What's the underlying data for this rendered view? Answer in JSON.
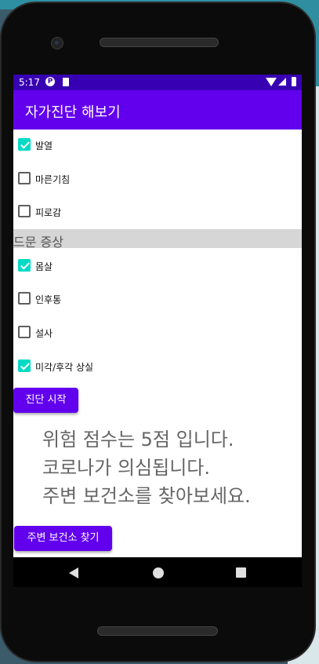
{
  "status_bar": {
    "time": "5:17"
  },
  "app_bar": {
    "title": "자가진단 해보기"
  },
  "checkboxes": [
    {
      "label": "발열",
      "checked": true
    },
    {
      "label": "마른기침",
      "checked": false
    },
    {
      "label": "피로감",
      "checked": false
    }
  ],
  "section_title": "드문 증상",
  "rare_checkboxes": [
    {
      "label": "몸살",
      "checked": true
    },
    {
      "label": "인후통",
      "checked": false
    },
    {
      "label": "설사",
      "checked": false
    },
    {
      "label": "미각/후각 상실",
      "checked": true
    }
  ],
  "buttons": {
    "start": "진단 시작",
    "find": "주변 보건소 찾기"
  },
  "result": {
    "line1": "위험 점수는 5점 입니다.",
    "line2": "코로나가 의심됩니다.",
    "line3": "주변 보건소를 찾아보세요."
  },
  "colors": {
    "primary": "#6200ee",
    "status": "#3700b3",
    "checkbox": "#03dac5"
  }
}
